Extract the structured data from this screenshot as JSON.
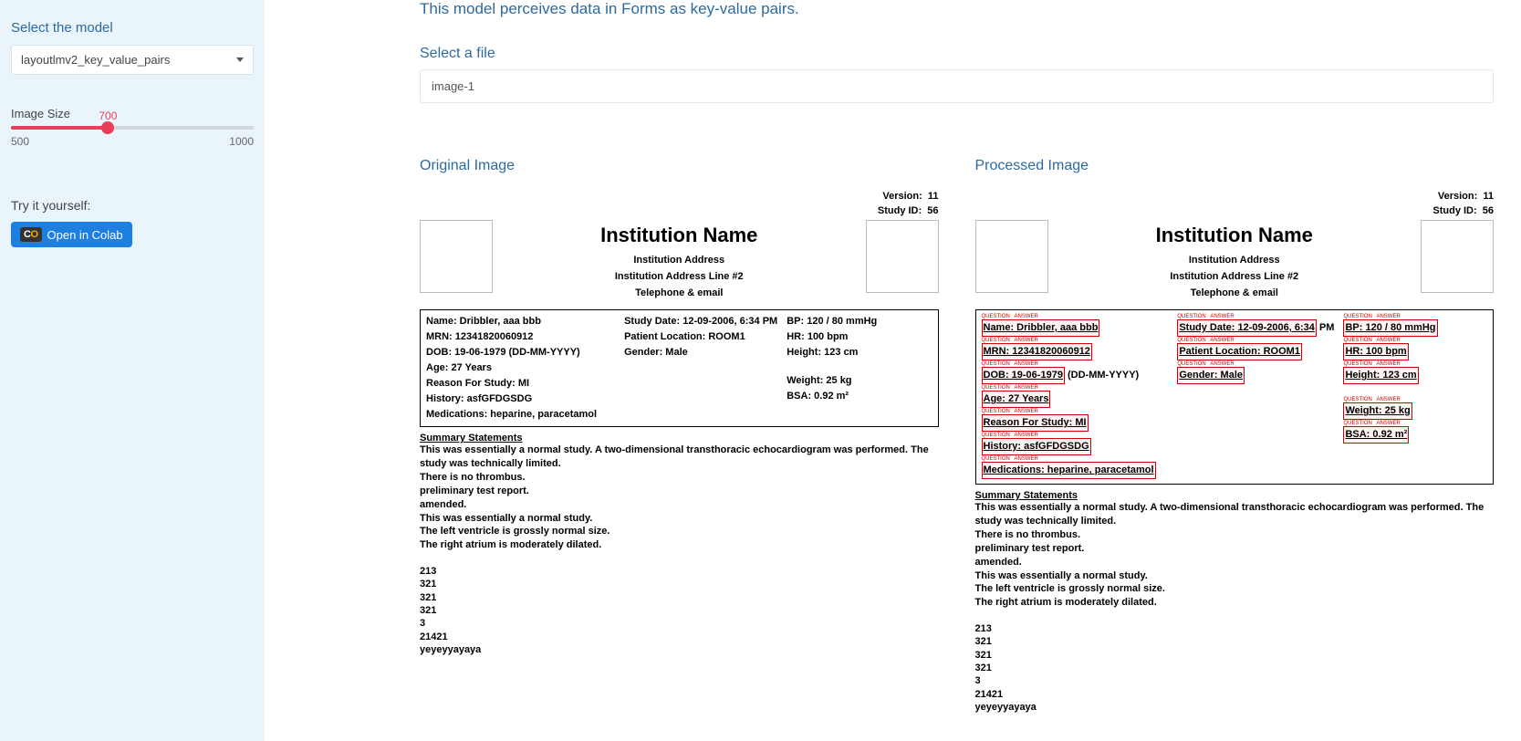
{
  "sidebar": {
    "model_heading": "Select the model",
    "model_selected": "layoutlmv2_key_value_pairs",
    "image_size_label": "Image Size",
    "image_size_value": "700",
    "image_size_min": "500",
    "image_size_max": "1000",
    "try_label": "Try it yourself:",
    "colab_label": "Open in Colab"
  },
  "main": {
    "subtitle": "This model perceives data in Forms as key-value pairs.",
    "file_heading": "Select a file",
    "file_selected": "image-1",
    "original_heading": "Original Image",
    "processed_heading": "Processed Image"
  },
  "doc": {
    "version_label": "Version:",
    "version_value": "11",
    "study_id_label": "Study ID:",
    "study_id_value": "56",
    "inst_name": "Institution Name",
    "inst_addr": "Institution Address",
    "inst_addr2": "Institution Address Line #2",
    "inst_tel": "Telephone & email",
    "col1": {
      "name": "Name:  Dribbler, aaa bbb",
      "mrn": "MRN:  12341820060912",
      "dob_a": "DOB:  19-06-1979",
      "dob_b": " (DD-MM-YYYY)",
      "age": "Age:  27 Years",
      "reason": "Reason For Study:  MI",
      "history": "History:  asfGFDGSDG",
      "meds": "Medications:  heparine, paracetamol"
    },
    "col2": {
      "study_date_a": "Study Date:  12-09-2006, 6:34",
      "study_date_b": " PM",
      "ploc": "Patient Location:  ROOM1",
      "gender": "Gender:  Male"
    },
    "col3": {
      "bp": "BP:  120 / 80 mmHg",
      "hr": "HR:  100 bpm",
      "height": "Height:  123 cm",
      "weight": "Weight:  25 kg",
      "bsa": "BSA:  0.92 m²"
    },
    "summary_h": "Summary Statements",
    "summary_lines": [
      "This was essentially a normal study. A two-dimensional transthoracic echocardiogram was performed. The study was technically limited.",
      "There is no thrombus.",
      "preliminary test report.",
      "amended.",
      "This was essentially a normal study.",
      "The left ventricle is grossly normal size.",
      "The right atrium is moderately dilated."
    ],
    "numbers": [
      "213",
      "321",
      "321",
      "321",
      "3",
      "21421",
      "yeyeyyayaya"
    ]
  },
  "ann": {
    "ques": "QUESTION",
    "ans": "ANSWER"
  }
}
